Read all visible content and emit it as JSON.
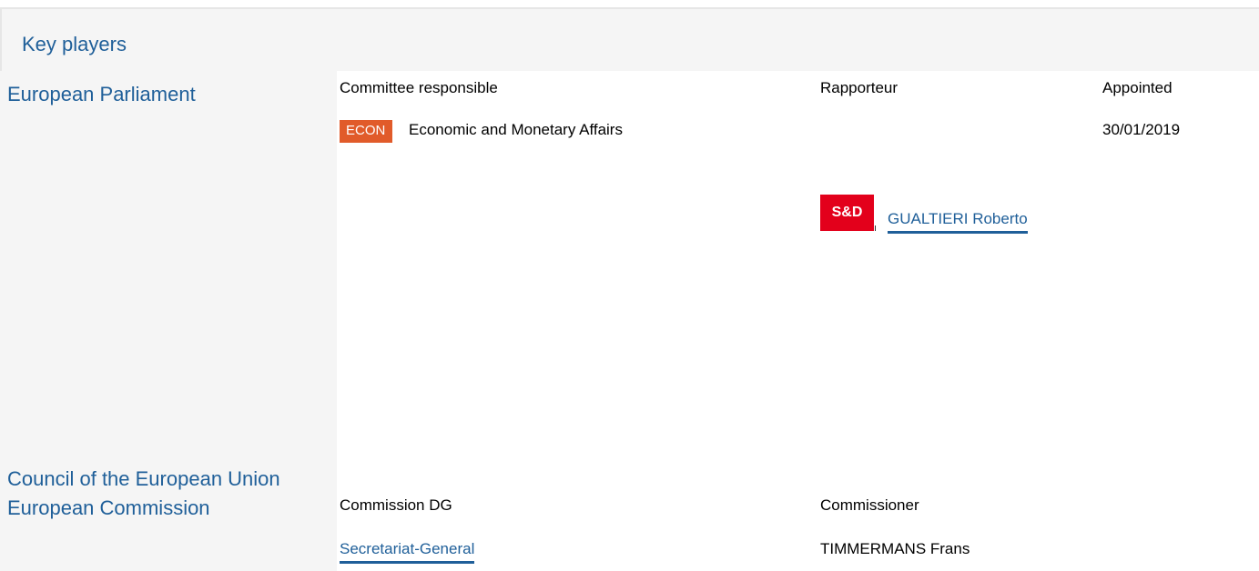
{
  "section": {
    "title": "Key players"
  },
  "institutions": {
    "parliament": "European Parliament",
    "council": "Council of the European Union",
    "commission": "European Commission"
  },
  "parliament": {
    "col_committee": "Committee responsible",
    "col_rapporteur": "Rapporteur",
    "col_appointed": "Appointed",
    "committee_code": "ECON",
    "committee_name": "Economic and Monetary Affairs",
    "appointed_date": "30/01/2019",
    "group_logo_text": "S&D",
    "rapporteur_name": "GUALTIERI Roberto"
  },
  "commission": {
    "col_dg": "Commission DG",
    "col_commissioner": "Commissioner",
    "dg_name": "Secretariat-General",
    "commissioner_name": "TIMMERMANS Frans"
  },
  "colors": {
    "link": "#1f5f99",
    "badge": "#e15b2a",
    "sd_red": "#e3001b",
    "panel_bg": "#f5f5f5"
  }
}
